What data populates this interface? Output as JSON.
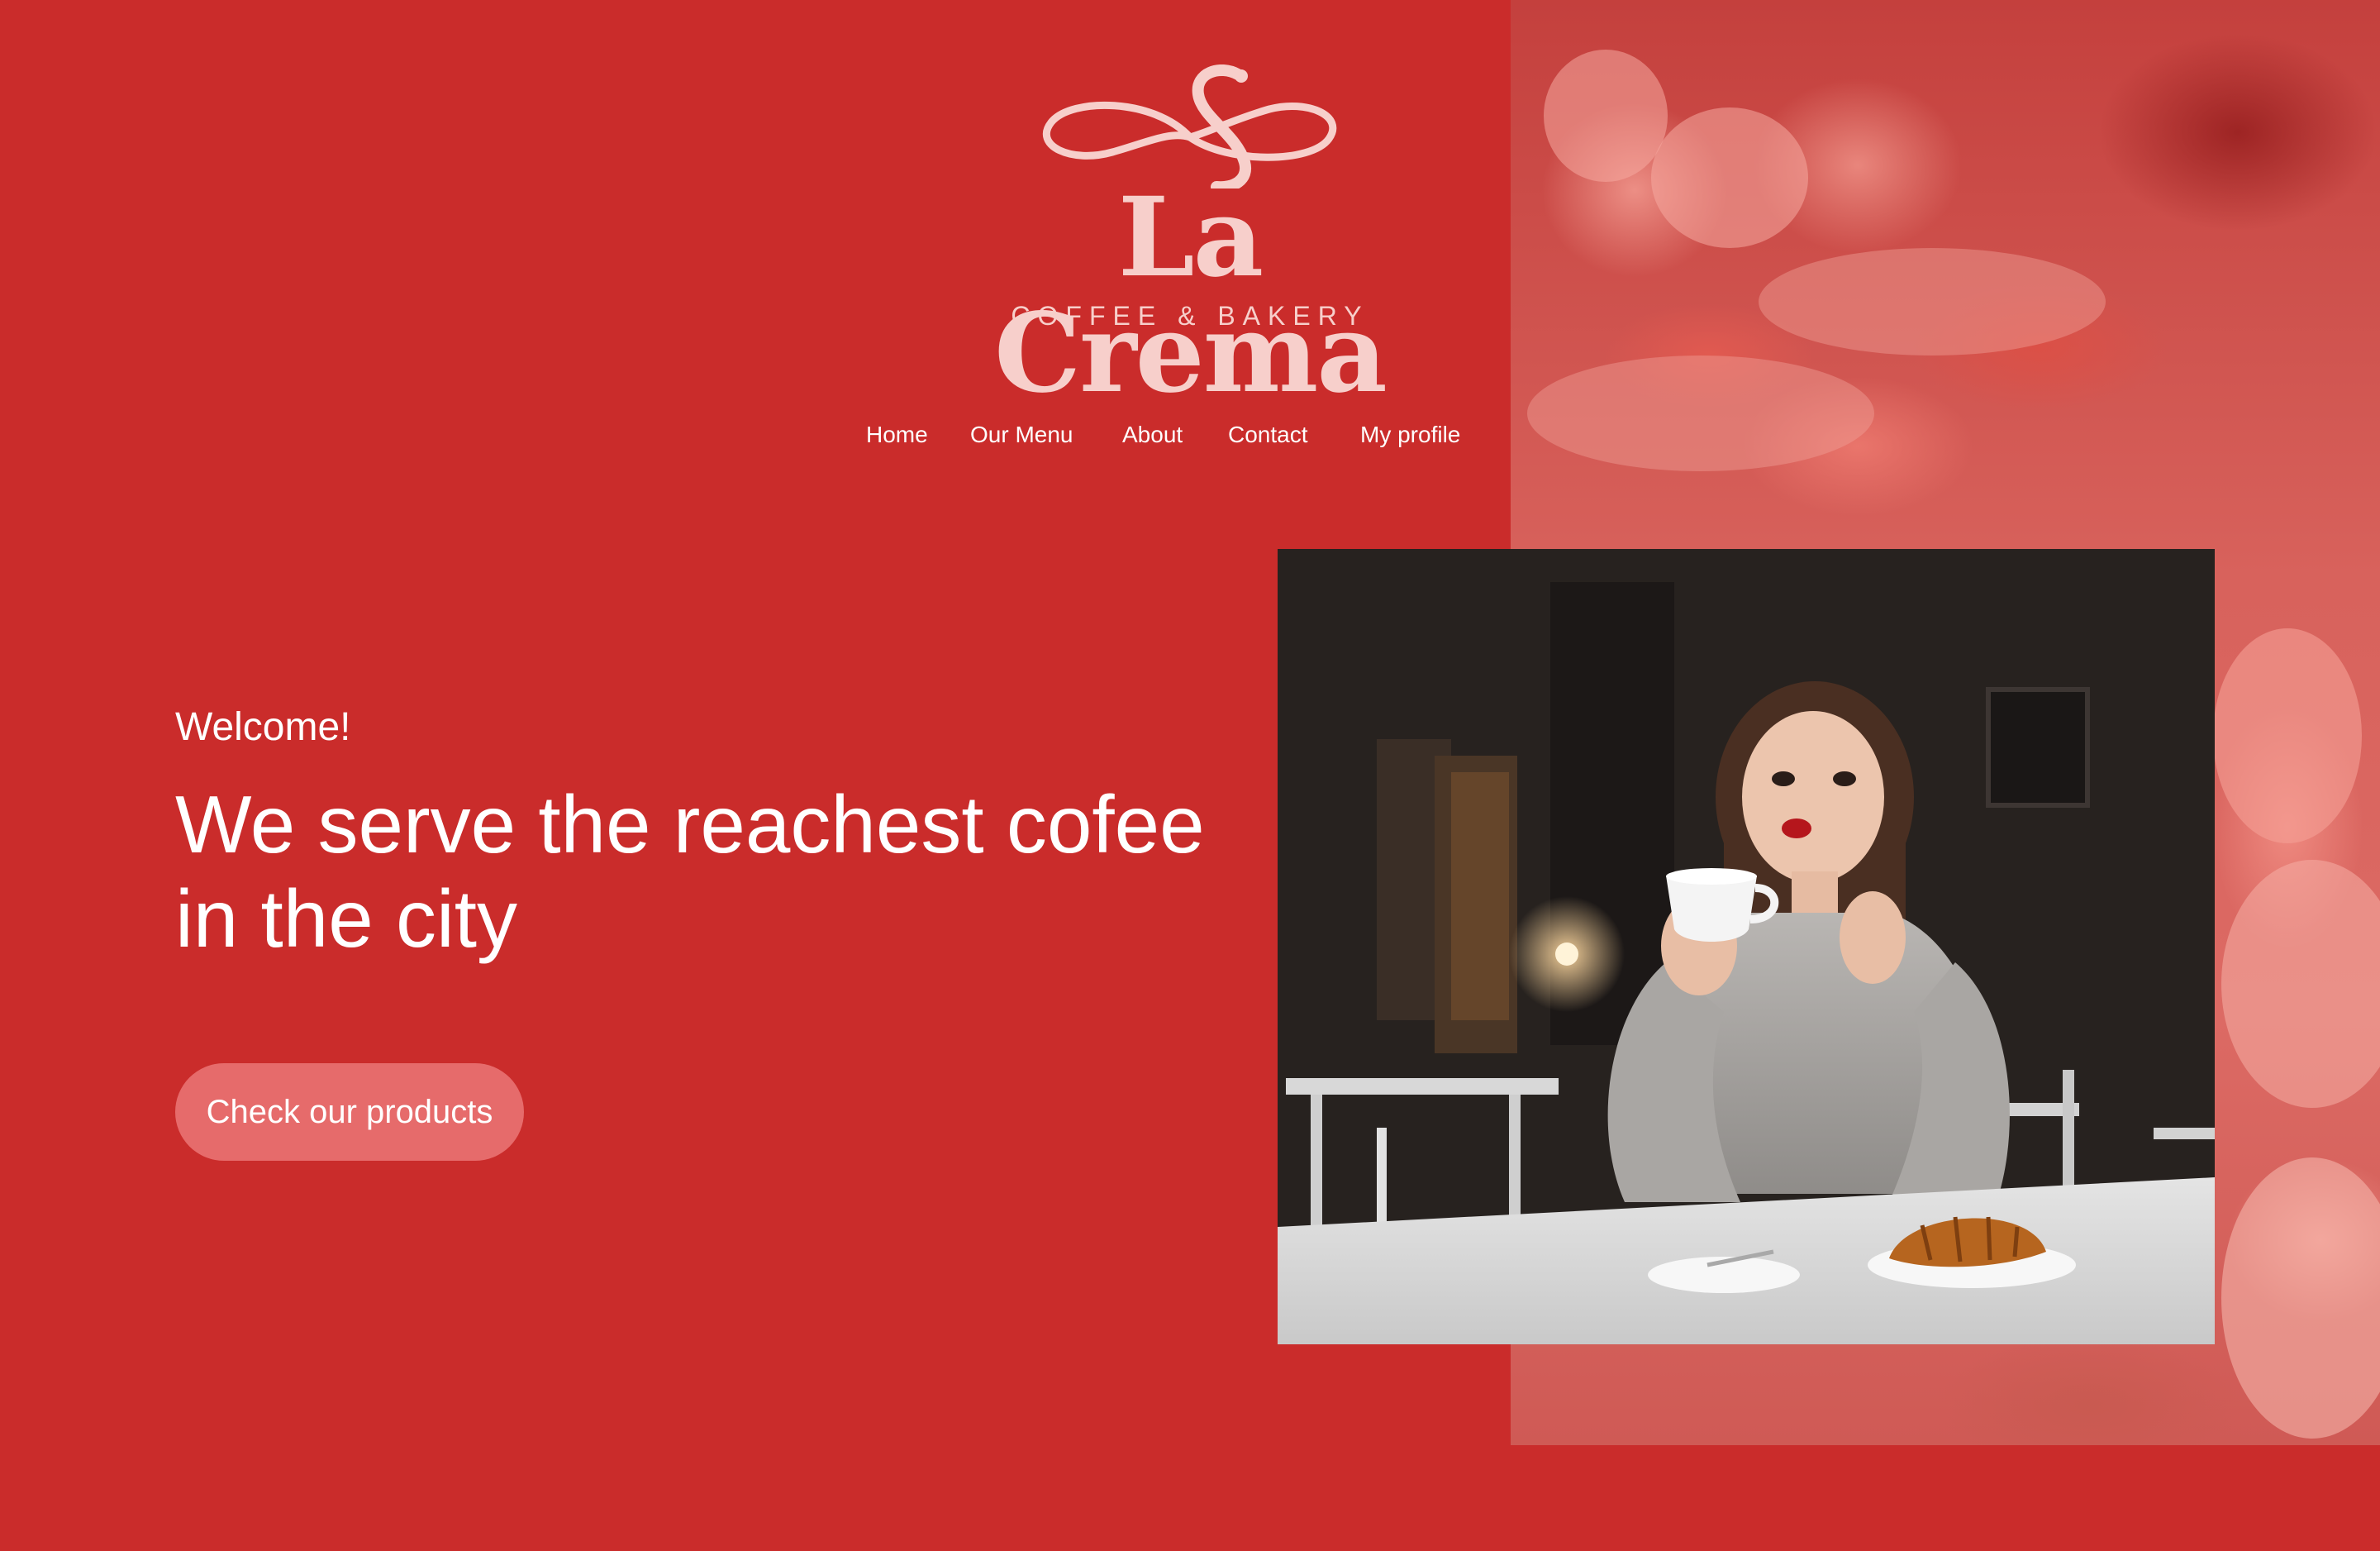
{
  "brand": {
    "name": "La Crema",
    "tagline": "COFFEE & BAKERY",
    "logo_color": "#f7cfcb"
  },
  "nav": {
    "items": [
      {
        "label": "Home"
      },
      {
        "label": "Our Menu"
      },
      {
        "label": "About"
      },
      {
        "label": "Contact"
      },
      {
        "label": "My profile"
      }
    ]
  },
  "hero": {
    "welcome": "Welcome!",
    "headline": "We serve the reachest cofee in the city",
    "cta_label": "Check our products"
  },
  "images": {
    "main_photo": "woman-drinking-coffee-photo",
    "background": "pastries-background-photo"
  },
  "colors": {
    "background": "#ca2c2b",
    "button": "#e66b6b",
    "text": "#ffffff"
  }
}
